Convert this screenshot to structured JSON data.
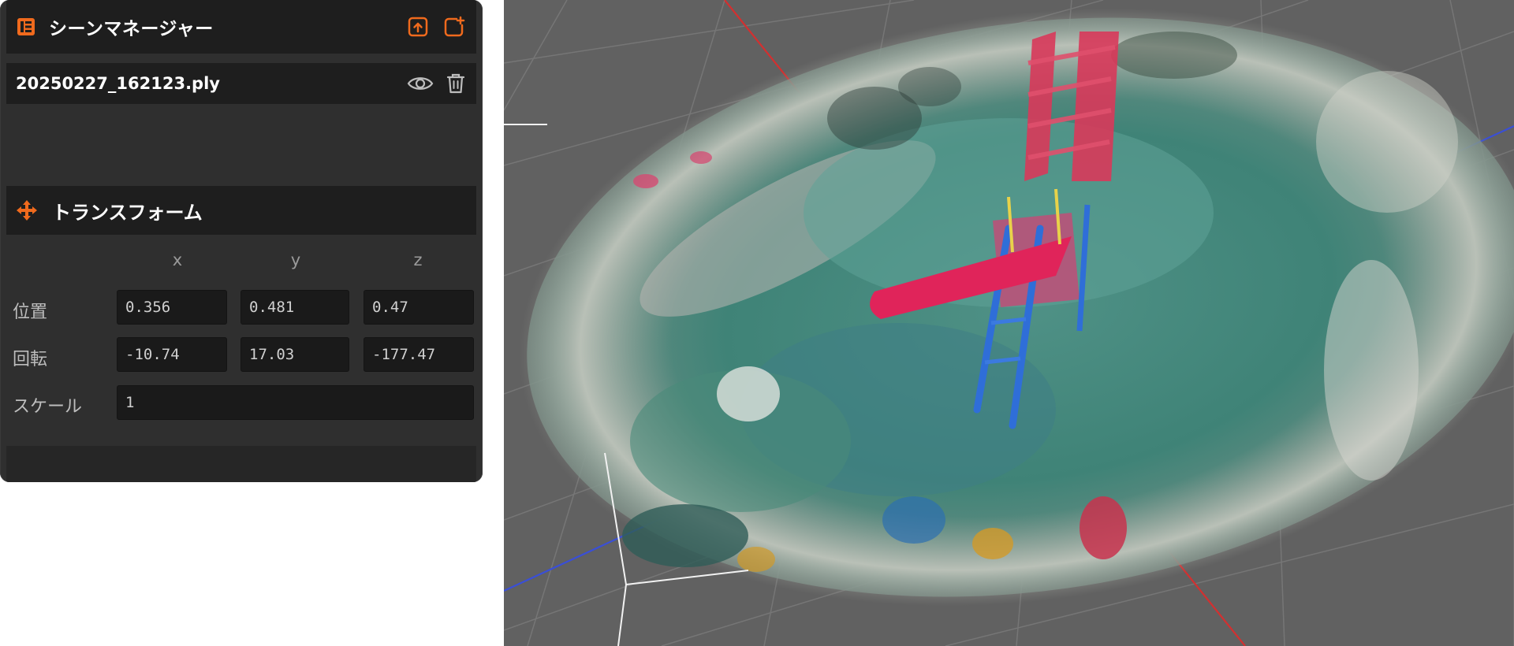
{
  "scene_manager": {
    "title": "シーンマネージャー",
    "header_icons": [
      "scene-logo-icon",
      "upload-icon",
      "add-icon"
    ]
  },
  "file": {
    "name": "20250227_162123.ply",
    "icons": [
      "eye-icon",
      "trash-icon"
    ]
  },
  "transform": {
    "title": "トランスフォーム",
    "icon": "move-arrows-icon",
    "axes": {
      "x": "x",
      "y": "y",
      "z": "z"
    },
    "position": {
      "label": "位置",
      "x": "0.356",
      "y": "0.481",
      "z": "0.47"
    },
    "rotation": {
      "label": "回転",
      "x": "-10.74",
      "y": "17.03",
      "z": "-177.47"
    },
    "scale": {
      "label": "スケール",
      "value": "1"
    }
  },
  "colors": {
    "accent": "#f06a1d",
    "panel_bg": "#2f2f2f",
    "header_bg": "#1e1e1e",
    "viewport_bg": "#616161",
    "axis_x": "#d23030",
    "axis_z": "#3a4fd6"
  }
}
